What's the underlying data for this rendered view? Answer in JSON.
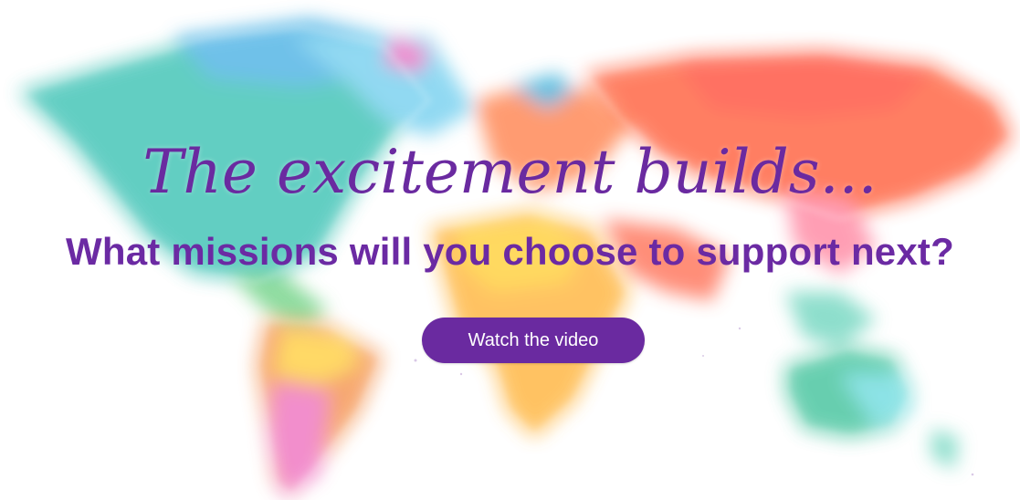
{
  "banner": {
    "headline": "The excitement builds...",
    "subheadline": "What missions will you choose to support next?",
    "cta_label": "Watch the video"
  },
  "colors": {
    "brand_purple": "#6a2aa0",
    "cta_text": "#ffffff",
    "background": "#ffffff"
  },
  "icons": {
    "map": "watercolor-world-map-illustration"
  }
}
